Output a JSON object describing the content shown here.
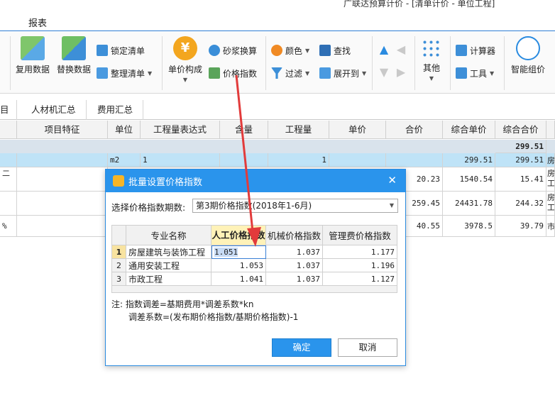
{
  "window": {
    "title": "广联达预算计价 - [清单计价 - 单位工程]"
  },
  "menu": {
    "tab": "报表"
  },
  "ribbon": {
    "reuse_data": "复用数据",
    "replace_data": "替换数据",
    "lock_list": "锁定清单",
    "organize_list": "整理清单",
    "unit_price": "单价构成",
    "mortar_convert": "砂浆换算",
    "price_index": "价格指数",
    "color": "颜色",
    "find": "查找",
    "filter": "过滤",
    "expand_to": "展开到",
    "other": "其他",
    "calculator": "计算器",
    "tools": "工具",
    "smart_price": "智能组价"
  },
  "subtabs": [
    "目",
    "人材机汇总",
    "费用汇总"
  ],
  "grid": {
    "headers": [
      "项目特征",
      "单位",
      "工程量表达式",
      "含量",
      "工程量",
      "单价",
      "合价",
      "综合单价",
      "综合合价"
    ],
    "total": "299.51",
    "rows": [
      {
        "unit": "m2",
        "expr": "1",
        "qty": "1",
        "unit_total": "299.51",
        "total_price": "299.51",
        "tail": "房"
      },
      {
        "lead": "二",
        "price": "20.23",
        "unit_total": "1540.54",
        "total_price": "15.41",
        "tail": "房工"
      },
      {
        "price": "259.45",
        "unit_total": "24431.78",
        "total_price": "244.32",
        "tail": "房工"
      },
      {
        "lead": "%",
        "price": "40.55",
        "unit_total": "3978.5",
        "total_price": "39.79",
        "tail": "市"
      }
    ]
  },
  "dialog": {
    "title": "批量设置价格指数",
    "period_label": "选择价格指数期数:",
    "period_value": "第3期价格指数(2018年1-6月)",
    "headers": {
      "name": "专业名称",
      "labor": "人工价格指数",
      "machine": "机械价格指数",
      "mgmt": "管理费价格指数"
    },
    "rows": [
      {
        "num": "1",
        "name": "房屋建筑与装饰工程",
        "labor": "1.051",
        "machine": "1.037",
        "mgmt": "1.177"
      },
      {
        "num": "2",
        "name": "通用安装工程",
        "labor": "1.053",
        "machine": "1.037",
        "mgmt": "1.196"
      },
      {
        "num": "3",
        "name": "市政工程",
        "labor": "1.041",
        "machine": "1.037",
        "mgmt": "1.127"
      }
    ],
    "note1": "注: 指数调差=基期费用*调差系数*kn",
    "note2": "调差系数=(发布期价格指数/基期价格指数)-1",
    "ok": "确定",
    "cancel": "取消"
  },
  "colors": {
    "accent": "#2a94ec",
    "selected_row": "#bfe3f7",
    "highlight_header": "#fff2b8",
    "annotation": "#e23b3b"
  }
}
